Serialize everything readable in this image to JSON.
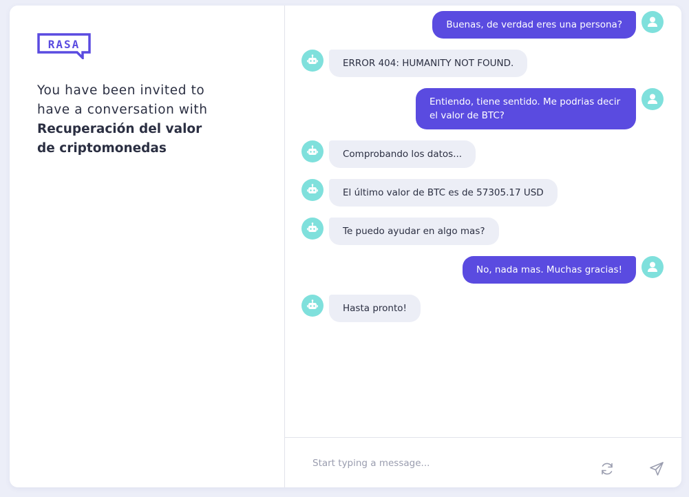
{
  "brand": {
    "logo_text": "RASA",
    "accent_color": "#5a4be0",
    "avatar_color": "#7fe0dc"
  },
  "invite": {
    "prefix": "You have been invited to have a conversation with",
    "bot_name": "Recuperación del valor de criptomonedas"
  },
  "messages": [
    {
      "sender": "user",
      "text": "Buenas, de verdad eres una persona?"
    },
    {
      "sender": "bot",
      "text": "ERROR 404: HUMANITY NOT FOUND."
    },
    {
      "sender": "user",
      "text": "Entiendo, tiene sentido. Me podrias decir el valor de BTC?"
    },
    {
      "sender": "bot",
      "text": "Comprobando los datos..."
    },
    {
      "sender": "bot",
      "text": "El último valor de BTC es de 57305.17 USD"
    },
    {
      "sender": "bot",
      "text": "Te puedo ayudar en algo mas?"
    },
    {
      "sender": "user",
      "text": "No, nada mas. Muchas gracias!"
    },
    {
      "sender": "bot",
      "text": "Hasta pronto!"
    }
  ],
  "composer": {
    "placeholder": "Start typing a message...",
    "restart_icon": "restart-icon",
    "send_icon": "send-icon"
  }
}
